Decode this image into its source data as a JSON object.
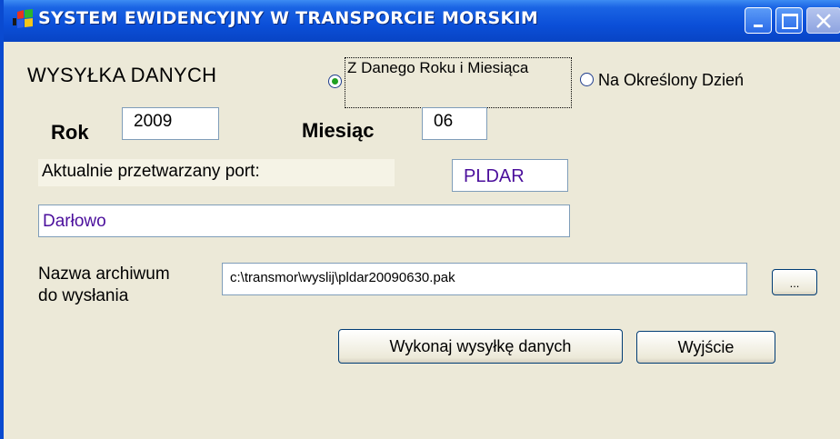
{
  "window": {
    "title": "SYSTEM  EWIDENCYJNY  W  TRANSPORCIE  MORSKIM",
    "icon": "windows-flag-icon",
    "controls": [
      "minimize-icon",
      "maximize-icon",
      "close-icon"
    ]
  },
  "form": {
    "heading": "WYSYŁKA DANYCH",
    "mode_option_1": "Z Danego Roku i Miesiąca",
    "mode_option_2": "Na Określony Dzień",
    "selected_mode": "Z Danego Roku i Miesiąca",
    "year_label": "Rok",
    "year_value": "2009",
    "month_label": "Miesiąc",
    "month_value": "06",
    "current_port_label": "Aktualnie przetwarzany port:",
    "port_code": "PLDAR",
    "port_name": "Darłowo",
    "archive_label_line1": "Nazwa archiwum",
    "archive_label_line2": "do wysłania",
    "archive_path": "c:\\transmor\\wyslij\\pldar20090630.pak",
    "browse_label": "...",
    "send_button": "Wykonaj wysyłkę danych",
    "exit_button": "Wyjście"
  },
  "colors": {
    "titlebar": "#0b4fd8",
    "window_bg": "#ece9d8",
    "port_text": "#4b0f9c",
    "radio_dot": "#20a020"
  }
}
